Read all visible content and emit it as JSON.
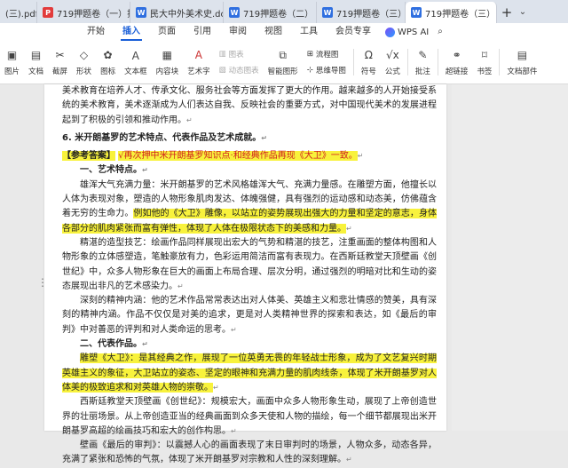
{
  "tabs": [
    {
      "label": "(三).pdf",
      "icon": "pdf-file-icon",
      "kind": "pdf"
    },
    {
      "label": "719押题卷（一）押",
      "icon": "pdf-file-icon",
      "kind": "pdf"
    },
    {
      "label": "民大中外美术史.docx",
      "icon": "word-file-icon",
      "kind": "word"
    },
    {
      "label": "719押题卷（二）",
      "icon": "word-file-icon",
      "kind": "word"
    },
    {
      "label": "719押题卷（三）",
      "icon": "word-file-icon",
      "kind": "word"
    },
    {
      "label": "719押题卷（三）",
      "icon": "word-file-icon",
      "kind": "word",
      "active": true
    }
  ],
  "menu": [
    "开始",
    "插入",
    "页面",
    "引用",
    "审阅",
    "视图",
    "工具",
    "会员专享"
  ],
  "menu_active": "插入",
  "wps_ai": "WPS AI",
  "ribbon": {
    "picture": "图片",
    "textbox_doc": "文档",
    "screenshot": "截屏",
    "shape": "形状",
    "icon": "图标",
    "textbox": "文本框",
    "content_lib": "内容块",
    "art_text": "艺术字",
    "dim1": "图表",
    "dim2": "动态图表",
    "smart_shape": "智能图形",
    "flowchart": "流程图",
    "mindmap": "思维导图",
    "symbol": "符号",
    "formula": "公式",
    "comment": "批注",
    "hyperlink": "超链接",
    "bookmark": "书签",
    "doc_parts": "文档部件"
  },
  "doc": {
    "p1": "美术教育在培养人才、传承文化、服务社会等方面发挥了更大的作用。越来越多的人开始接受系统的美术教育，美术逐渐成为人们表达自我、反映社会的重要方式，对中国现代美术的发展进程起到了积极的引领和推动作用。",
    "q6": "6.  米开朗基罗的艺术特点、代表作品及艺术成就。",
    "answer_label": "【参考答案】",
    "answer_note": "√再次押中米开朗基罗知识点·和经典作品再现《大卫》一致。",
    "h1": "一、艺术特点。",
    "p2a": "雄浑大气充满力量：米开朗基罗的艺术风格雄浑大气、充满力量感。在雕塑方面，他擅长以人体为表现对象，塑造的人物形象肌肉发达、体魄强健，具有强烈的运动感和动态美，仿佛蕴含着无穷的生命力。",
    "p2b": "例如他的《大卫》雕像，以站立的姿势展现出强大的力量和坚定的意志，身体各部分的肌肉紧张而富有弹性，体现了人体在极限状态下的美感和力量。",
    "p3": "精湛的造型技艺：绘画作品同样展现出宏大的气势和精湛的技艺，注重画面的整体构图和人物形象的立体感塑造，笔触豪放有力，色彩运用简洁而富有表现力。在西斯廷教堂天顶壁画《创世纪》中，众多人物形象在巨大的画面上布局合理、层次分明，通过强烈的明暗对比和生动的姿态展现出非凡的艺术感染力。",
    "p4": "深刻的精神内涵：他的艺术作品常常表达出对人体美、英雄主义和悲壮情感的赞美，具有深刻的精神内涵。作品不仅仅是对美的追求，更是对人类精神世界的探索和表达，如《最后的审判》中对善恶的评判和对人类命运的思考。",
    "h2": "二、代表作品。",
    "p5": "雕塑《大卫》：是其经典之作，展现了一位英勇无畏的年轻战士形象，成为了文艺复兴时期英雄主义的象征，大卫站立的姿态、坚定的眼神和充满力量的肌肉线条，体现了米开朗基罗对人体美的极致追求和对英雄人物的崇敬。",
    "p6": "西斯廷教堂天顶壁画《创世纪》：规模宏大，画面中众多人物形象生动，展现了上帝创造世界的壮丽场景。从上帝创造亚当的经典画面到众多天使和人物的描绘，每一个细节都展现出米开朗基罗高超的绘画技巧和宏大的创作构思。",
    "p7": "壁画《最后的审判》：以震撼人心的画面表现了末日审判时的场景，人物众多，动态各异，充满了紧张和恐怖的气氛，体现了米开朗基罗对宗教和人性的深刻理解。"
  },
  "colors": {
    "highlight": "#f8f23c",
    "accent": "#1a5fd8",
    "red": "#d11f1f"
  }
}
